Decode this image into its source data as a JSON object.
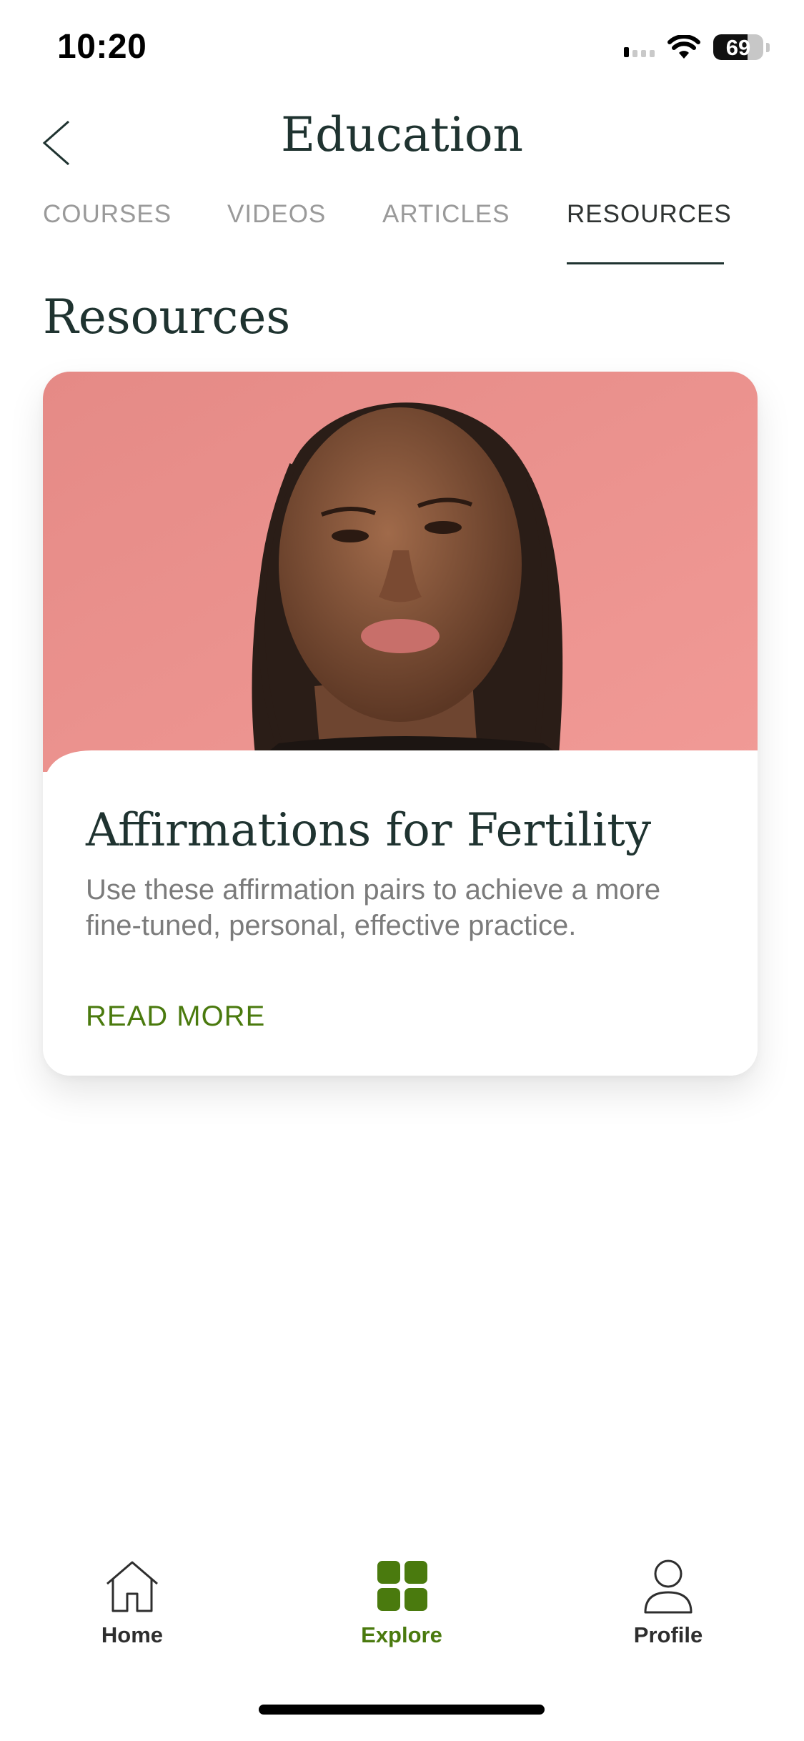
{
  "status_bar": {
    "time": "10:20",
    "battery_level": "69",
    "icons": [
      "cellular-signal-icon",
      "wifi-icon",
      "battery-icon"
    ]
  },
  "header": {
    "title": "Education",
    "back_icon": "chevron-left-icon"
  },
  "tabs": [
    {
      "label": "COURSES",
      "active": false
    },
    {
      "label": "VIDEOS",
      "active": false
    },
    {
      "label": "ARTICLES",
      "active": false
    },
    {
      "label": "RESOURCES",
      "active": true
    }
  ],
  "section": {
    "title": "Resources"
  },
  "card": {
    "title": "Affirmations for Fertility",
    "description": "Use these affirmation pairs to achieve a more fine-tuned, personal, effective practice.",
    "link_label": "READ MORE"
  },
  "bottom_nav": {
    "items": [
      {
        "label": "Home",
        "icon": "home-icon",
        "active": false
      },
      {
        "label": "Explore",
        "icon": "grid-icon",
        "active": true
      },
      {
        "label": "Profile",
        "icon": "person-icon",
        "active": false
      }
    ]
  },
  "colors": {
    "accent": "#4a7a0e",
    "title": "#1f3330",
    "muted": "#9a9a9a",
    "card_image_background": "#e98f8c"
  }
}
